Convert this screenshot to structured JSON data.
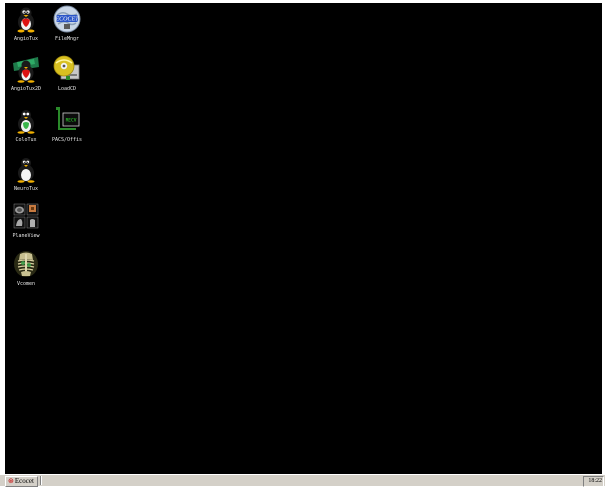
{
  "desktop": {
    "background_color": "#000000",
    "icons": [
      {
        "label": "AngioTux",
        "icon": "tux-angio-icon"
      },
      {
        "label": "FileMngr",
        "icon": "ecocet-filemanager-icon"
      },
      {
        "label": "AngioTux2D",
        "icon": "tux-angio2d-icon"
      },
      {
        "label": "LoadCD",
        "icon": "cd-drive-icon"
      },
      {
        "label": "ColoTux",
        "icon": "tux-colo-icon"
      },
      {
        "label": "PACS/Offis",
        "icon": "pacs-recv-icon"
      },
      {
        "label": "NeuroTux",
        "icon": "tux-neuro-icon"
      },
      {
        "label": "PlaneView",
        "icon": "planeview-icon"
      },
      {
        "label": "Vcomen",
        "icon": "skeleton-icon"
      }
    ]
  },
  "taskbar": {
    "task_label": "Ecocet",
    "task_icon": "ecocet-icon",
    "clock": "18:22"
  }
}
